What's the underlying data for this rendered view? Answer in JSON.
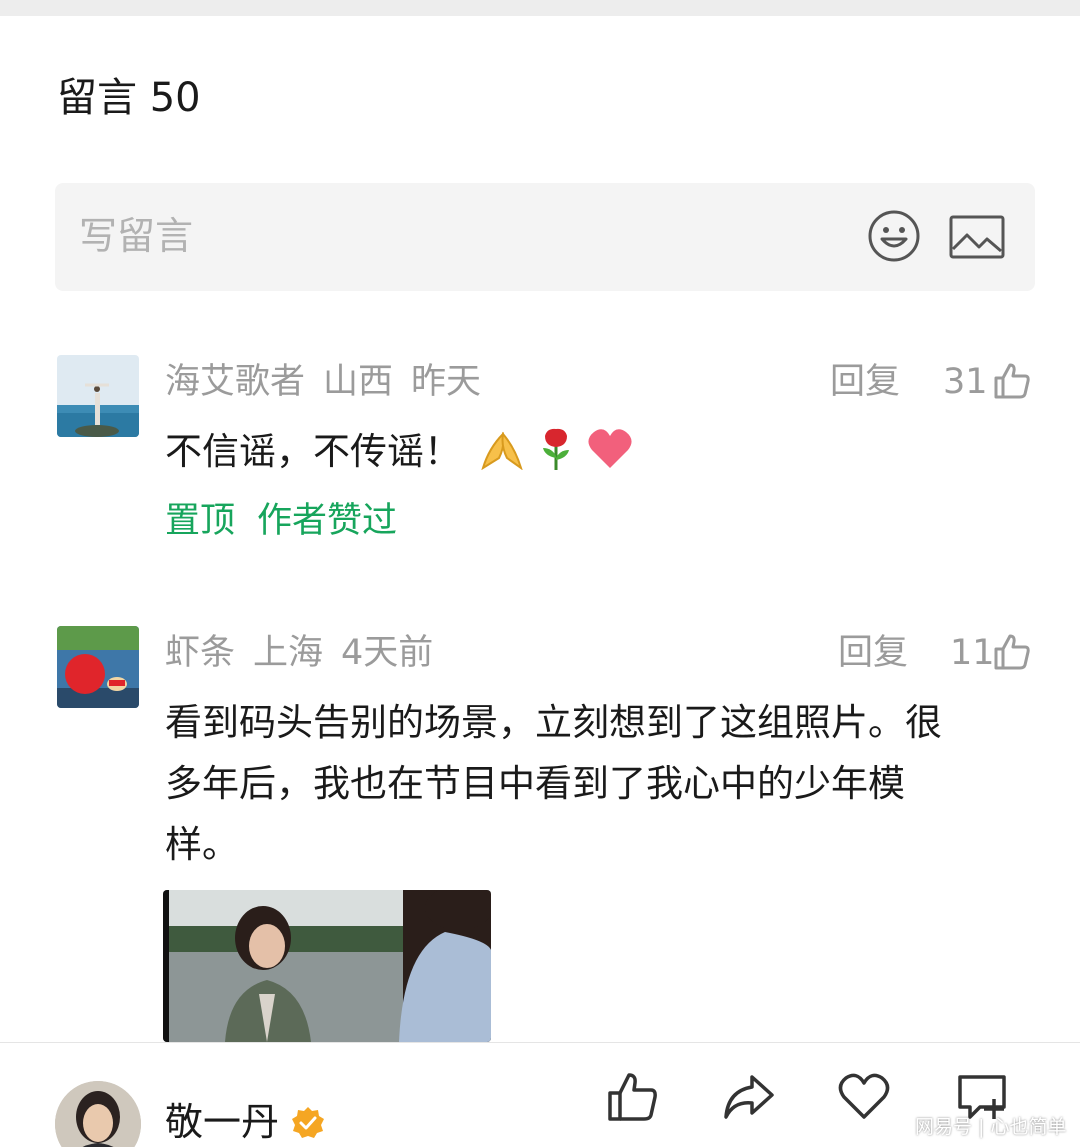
{
  "section": {
    "title": "留言 50"
  },
  "composer": {
    "placeholder": "写留言",
    "emoji_icon": "smiley-icon",
    "image_icon": "image-icon"
  },
  "comments": [
    {
      "author": "海艾歌者",
      "location": "山西",
      "time": "昨天",
      "reply_label": "回复",
      "likes": "31",
      "text": "不信谣，不传谣！",
      "emojis": [
        "folded-hands",
        "rose",
        "heart"
      ],
      "tags": [
        "置顶",
        "作者赞过"
      ]
    },
    {
      "author": "虾条",
      "location": "上海",
      "time": "4天前",
      "reply_label": "回复",
      "likes": "11",
      "text_lines": [
        "看到码头告别的场景，立刻想到了这组照片。很",
        "多年后，我也在节目中看到了我心中的少年模",
        "样。"
      ]
    }
  ],
  "bottom_bar": {
    "author_name": "敬一丹",
    "watermark": "网易号 | 心也简单"
  },
  "colors": {
    "accent_green": "#17a55c",
    "meta_gray": "#9b9b9b",
    "verified_gold": "#f5a623"
  }
}
